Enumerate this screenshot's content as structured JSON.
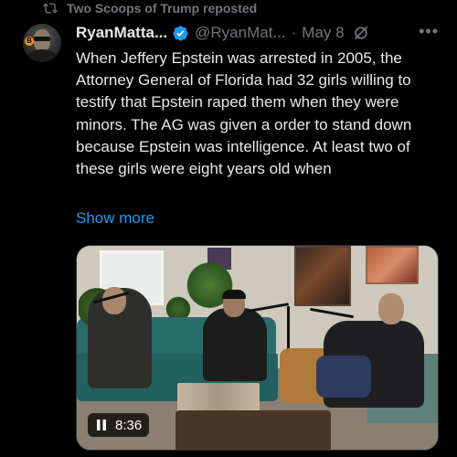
{
  "repost": {
    "label": "Two Scoops of Trump reposted",
    "icon": "repost-icon"
  },
  "author": {
    "display_name": "RyanMatta...",
    "handle": "@RyanMat...",
    "separator": "·",
    "date": "May 8",
    "verified_color": "#1d9bf0"
  },
  "tweet": {
    "text": "When Jeffery Epstein was arrested in 2005, the Attorney General of Florida had 32 girls willing to testify that Epstein raped them when they were minors. The AG was given a order to stand down because Epstein was intelligence. At least two of these girls were eight years old when",
    "show_more_label": "Show more"
  },
  "media": {
    "type": "video",
    "duration": "8:36",
    "state": "playing"
  },
  "colors": {
    "background": "#000000",
    "text": "#e7e9ea",
    "muted": "#71767b",
    "link": "#1d9bf0"
  }
}
